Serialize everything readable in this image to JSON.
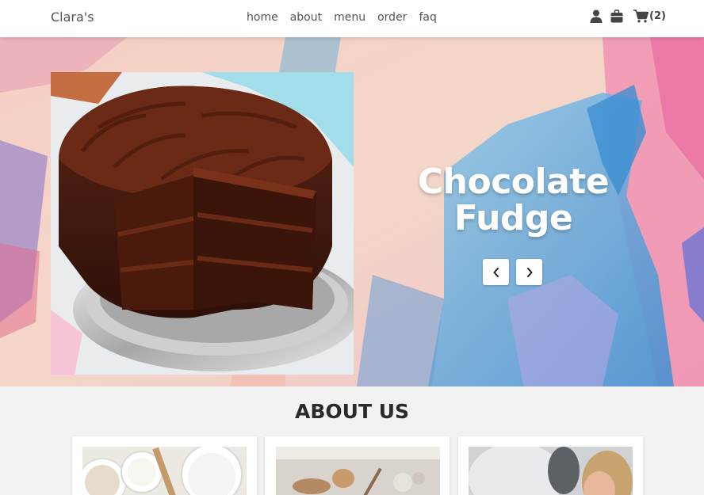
{
  "header": {
    "brand": "Clara's",
    "nav": [
      "home",
      "about",
      "menu",
      "order",
      "faq"
    ],
    "icons": [
      "user-icon",
      "gift-icon",
      "cart-icon"
    ],
    "cart_count": "(2)"
  },
  "hero": {
    "title_line1": "Chocolate",
    "title_line2": "Fudge",
    "prev_icon": "chevron-left-icon",
    "next_icon": "chevron-right-icon"
  },
  "about": {
    "heading": "ABOUT US"
  },
  "colors": {
    "nav_bg": "#ffffff",
    "page_bg": "#f2f2f2",
    "hero_pink": "#f2b8c6",
    "hero_blue": "#5fa8de"
  }
}
